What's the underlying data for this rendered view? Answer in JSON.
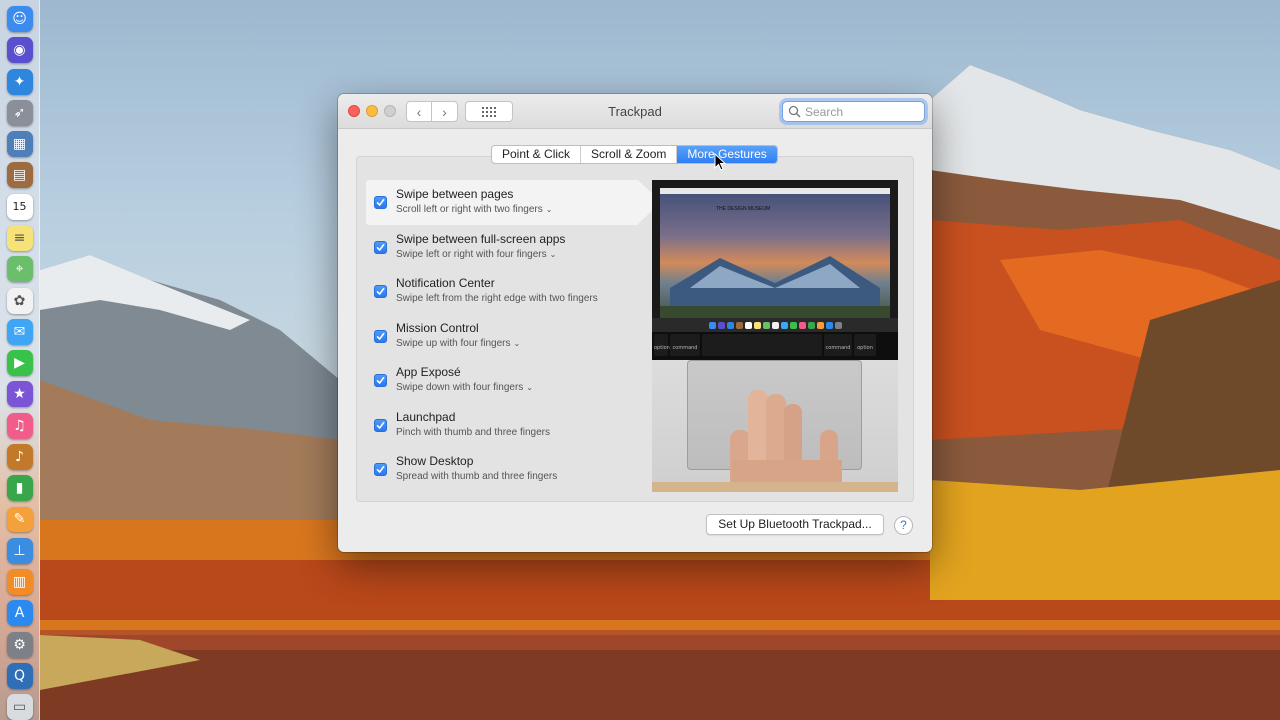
{
  "window": {
    "title": "Trackpad",
    "search_placeholder": "Search"
  },
  "tabs": [
    {
      "label": "Point & Click",
      "active": false
    },
    {
      "label": "Scroll & Zoom",
      "active": false
    },
    {
      "label": "More Gestures",
      "active": true
    }
  ],
  "gestures": [
    {
      "title": "Swipe between pages",
      "subtitle": "Scroll left or right with two fingers",
      "checked": true,
      "has_menu": true,
      "selected": true
    },
    {
      "title": "Swipe between full-screen apps",
      "subtitle": "Swipe left or right with four fingers",
      "checked": true,
      "has_menu": true,
      "selected": false
    },
    {
      "title": "Notification Center",
      "subtitle": "Swipe left from the right edge with two fingers",
      "checked": true,
      "has_menu": false,
      "selected": false
    },
    {
      "title": "Mission Control",
      "subtitle": "Swipe up with four fingers",
      "checked": true,
      "has_menu": true,
      "selected": false
    },
    {
      "title": "App Exposé",
      "subtitle": "Swipe down with four fingers",
      "checked": true,
      "has_menu": true,
      "selected": false
    },
    {
      "title": "Launchpad",
      "subtitle": "Pinch with thumb and three fingers",
      "checked": true,
      "has_menu": false,
      "selected": false
    },
    {
      "title": "Show Desktop",
      "subtitle": "Spread with thumb and three fingers",
      "checked": true,
      "has_menu": false,
      "selected": false
    }
  ],
  "preview": {
    "keys": [
      "option",
      "command",
      "command",
      "option"
    ]
  },
  "footer": {
    "bluetooth_button": "Set Up Bluetooth Trackpad...",
    "help_label": "?"
  },
  "dock": {
    "calendar_day": "15",
    "items": [
      {
        "name": "finder-icon",
        "color": "#3c8cf0",
        "glyph": "☺"
      },
      {
        "name": "siri-icon",
        "color": "#5a4fcf",
        "glyph": "◉"
      },
      {
        "name": "safari-icon",
        "color": "#2e86de",
        "glyph": "✦"
      },
      {
        "name": "launchpad-icon",
        "color": "#8a8f99",
        "glyph": "➶"
      },
      {
        "name": "preview-icon",
        "color": "#4f7fb8",
        "glyph": "▦"
      },
      {
        "name": "notes-book-icon",
        "color": "#9c6b3f",
        "glyph": "▤"
      },
      {
        "name": "calendar-icon",
        "color": "#ffffff",
        "glyph": "15"
      },
      {
        "name": "notes-icon",
        "color": "#f7e27a",
        "glyph": "≡"
      },
      {
        "name": "maps-icon",
        "color": "#6bbf6b",
        "glyph": "⌖"
      },
      {
        "name": "photos-icon",
        "color": "#f2f2f2",
        "glyph": "✿"
      },
      {
        "name": "messages-icon",
        "color": "#3fa6f5",
        "glyph": "✉"
      },
      {
        "name": "facetime-icon",
        "color": "#39c24a",
        "glyph": "▶"
      },
      {
        "name": "imovie-icon",
        "color": "#7b55d6",
        "glyph": "★"
      },
      {
        "name": "itunes-icon",
        "color": "#f25c8a",
        "glyph": "♫"
      },
      {
        "name": "garageband-icon",
        "color": "#c27a2a",
        "glyph": "♪"
      },
      {
        "name": "numbers-icon",
        "color": "#38a64a",
        "glyph": "▮"
      },
      {
        "name": "pages-icon",
        "color": "#f4a13c",
        "glyph": "✎"
      },
      {
        "name": "keynote-icon",
        "color": "#3a8de0",
        "glyph": "⊥"
      },
      {
        "name": "ibooks-icon",
        "color": "#f28c28",
        "glyph": "▥"
      },
      {
        "name": "app-store-icon",
        "color": "#2a8af0",
        "glyph": "A"
      },
      {
        "name": "system-preferences-icon",
        "color": "#7d8187",
        "glyph": "⚙"
      },
      {
        "name": "quicktime-icon",
        "color": "#2f6fb8",
        "glyph": "Q"
      },
      {
        "name": "trash-icon",
        "color": "#d8dce0",
        "glyph": "▭"
      }
    ]
  }
}
